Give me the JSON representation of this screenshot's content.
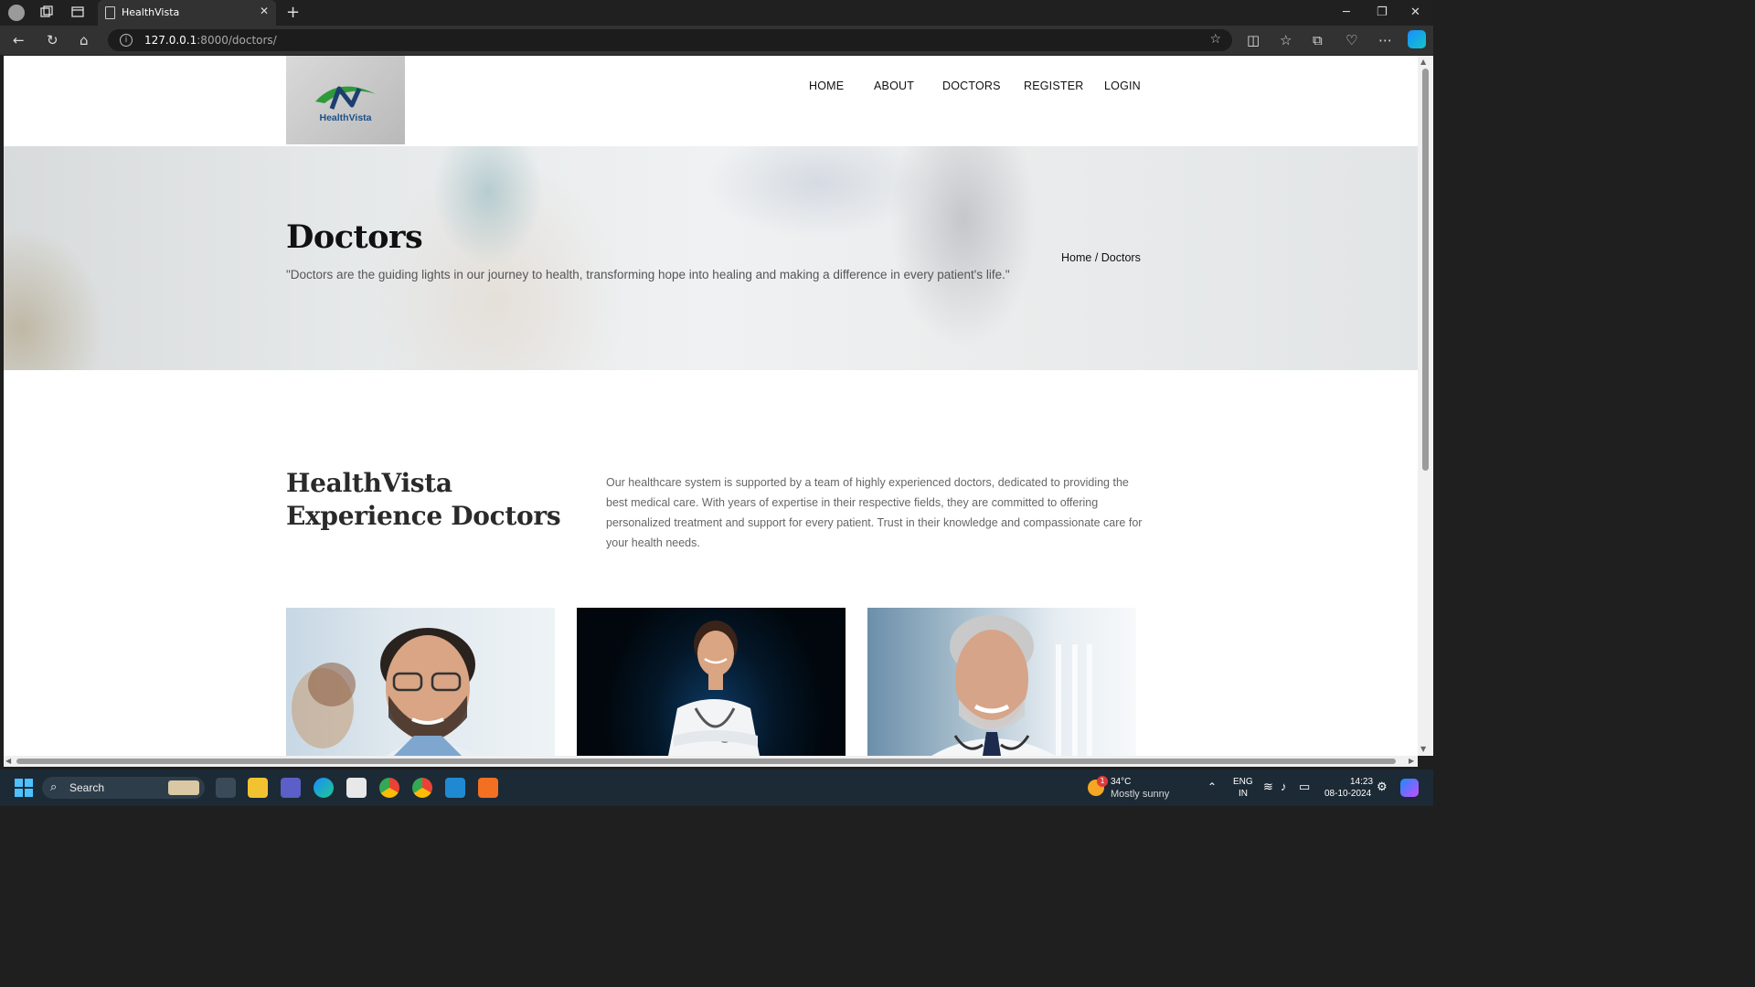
{
  "browser": {
    "tab_title": "HealthVista",
    "new_tab_symbol": "+",
    "tab_close_symbol": "✕",
    "address_host": "127.0.0.1",
    "address_path": ":8000/doctors/",
    "info_symbol": "i",
    "star_symbol": "☆"
  },
  "site": {
    "logo_text": "HealthVista",
    "nav": [
      "HOME",
      "ABOUT",
      "DOCTORS",
      "REGISTER",
      "LOGIN"
    ]
  },
  "banner": {
    "title": "Doctors",
    "quote": "\"Doctors are the guiding lights in our journey to health, transforming hope into healing and making a difference in every patient's life.\"",
    "breadcrumb": "Home / Doctors"
  },
  "section": {
    "title_line1": "HealthVista",
    "title_line2": "Experience Doctors",
    "description": "Our healthcare system is supported by a team of highly experienced doctors, dedicated to providing the best medical care. With years of expertise in their respective fields, they are committed to offering personalized treatment and support for every patient. Trust in their knowledge and compassionate care for your health needs."
  },
  "taskbar": {
    "search_label": "Search",
    "weather_temp": "34°C",
    "weather_desc": "Mostly sunny",
    "weather_badge": "1",
    "lang_line1": "ENG",
    "lang_line2": "IN",
    "time": "14:23",
    "date": "08-10-2024"
  },
  "colors": {
    "accent_blue": "#1b4f86",
    "logo_green": "#2e9a3a"
  }
}
